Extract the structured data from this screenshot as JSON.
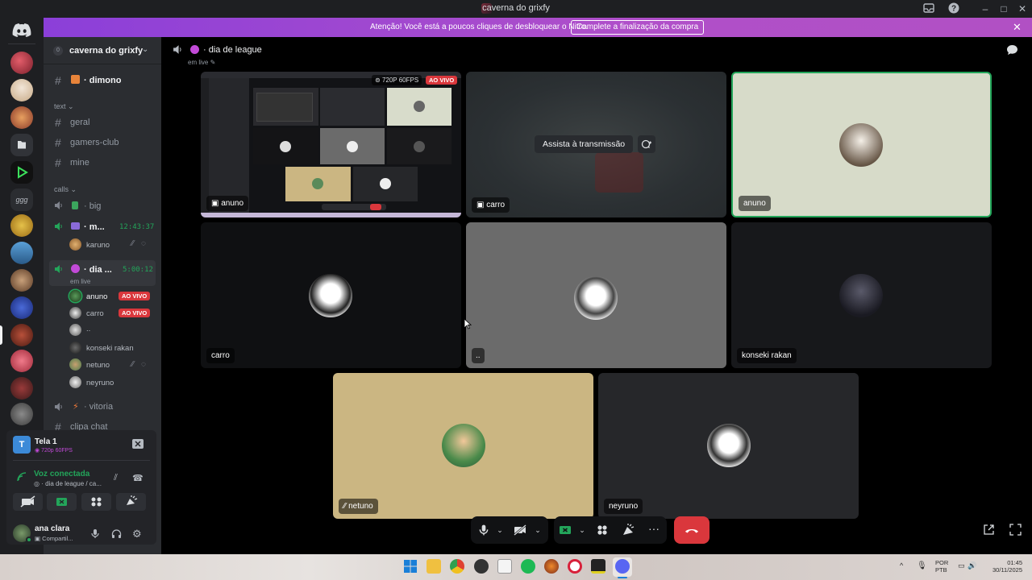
{
  "window": {
    "title": "caverna do grixfy"
  },
  "banner": {
    "text": "Atenção! Você está a poucos cliques de desbloquear o Nitro.",
    "button": "Complete a finalização da compra"
  },
  "guild": {
    "name": "caverna do grixfy",
    "boost_level": "0"
  },
  "sidebar": {
    "top_channel": "dimono",
    "text_category": "text",
    "text_channels": [
      "geral",
      "gamers-club",
      "mine"
    ],
    "calls_category": "calls",
    "voice_channels": {
      "big": "big",
      "m": "m...",
      "m_timer": "12:43:37",
      "m_user": "karuno",
      "dia": "dia ...",
      "dia_timer": "5:00:12",
      "dia_status": "em live",
      "vitoria": "vitoria",
      "clipa": "clipa chat"
    },
    "voice_users": [
      {
        "name": "anuno",
        "live": "AO VIVO"
      },
      {
        "name": "carro",
        "live": "AO VIVO"
      },
      {
        "name": "..",
        "live": ""
      },
      {
        "name": "konseki rakan",
        "live": ""
      },
      {
        "name": "netuno",
        "live": ""
      },
      {
        "name": "neyruno",
        "live": ""
      }
    ]
  },
  "stream_panel": {
    "title": "Tela 1",
    "quality": "720p 60FPS",
    "voice_status": "Voz conectada",
    "voice_channel": "dia de league / ca...",
    "user_name": "ana clara",
    "user_status": "Compartil..."
  },
  "call_header": {
    "channel": "dia de league",
    "status": "em live"
  },
  "tiles": {
    "anuno_stream": {
      "label": "anuno",
      "quality": "720P 60FPS",
      "live": "AO VIVO"
    },
    "carro_stream": {
      "label": "carro",
      "watch_button": "Assista à transmissão"
    },
    "anuno": "anuno",
    "carro": "carro",
    "dots": "..",
    "konseki": "konseki rakan",
    "netuno": "netuno",
    "neyruno": "neyruno"
  },
  "taskbar": {
    "lang1": "POR",
    "lang2": "PTB",
    "time": "01:45",
    "date": "30/11/2025"
  },
  "colors": {
    "accent_green": "#23a55a",
    "live_red": "#da373c",
    "nitro_purple": "#9b45d6",
    "hangup_red": "#da373c"
  }
}
